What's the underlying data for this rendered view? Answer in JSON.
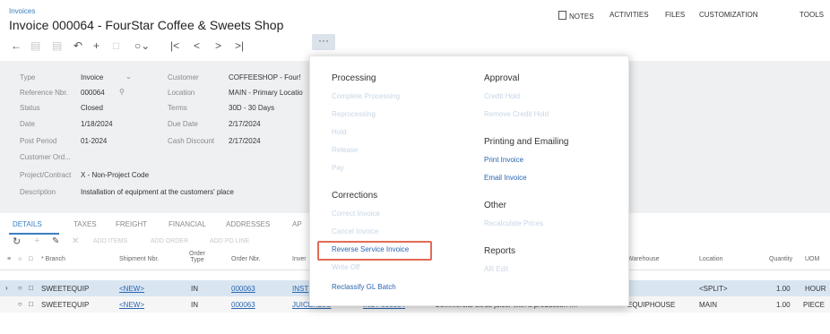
{
  "header": {
    "breadcrumb": "Invoices",
    "title": "Invoice 000064 - FourStar Coffee & Sweets Shop",
    "links": [
      "NOTES",
      "ACTIVITIES",
      "FILES",
      "CUSTOMIZATION",
      "TOOLS"
    ]
  },
  "toolbar": {
    "more": "···"
  },
  "form": {
    "type": {
      "label": "Type",
      "value": "Invoice"
    },
    "reference": {
      "label": "Reference Nbr.",
      "value": "000064"
    },
    "status": {
      "label": "Status",
      "value": "Closed"
    },
    "date": {
      "label": "Date",
      "value": "1/18/2024"
    },
    "post_period": {
      "label": "Post Period",
      "value": "01-2024"
    },
    "customer_ord": {
      "label": "Customer Ord..."
    },
    "project": {
      "label": "Project/Contract",
      "value": "X - Non-Project Code"
    },
    "description": {
      "label": "Description",
      "value": "Installation of equipment at the customers' place"
    },
    "customer": {
      "label": "Customer",
      "value": "COFFEESHOP - Four!"
    },
    "location": {
      "label": "Location",
      "value": "MAIN - Primary Locatio"
    },
    "terms": {
      "label": "Terms",
      "value": "30D - 30 Days"
    },
    "due_date": {
      "label": "Due Date",
      "value": "2/17/2024"
    },
    "cash_discount": {
      "label": "Cash Discount",
      "value": "2/17/2024"
    }
  },
  "tabs": [
    "DETAILS",
    "TAXES",
    "FREIGHT",
    "FINANCIAL",
    "ADDRESSES",
    "AP"
  ],
  "grid_toolbar": [
    "ADD ITEMS",
    "ADD ORDER",
    "ADD PO LINE"
  ],
  "columns": [
    "* Branch",
    "Shipment Nbr.",
    "Order Type",
    "Order Nbr.",
    "Inver",
    "Warehouse",
    "Location",
    "Quantity",
    "UOM"
  ],
  "rows": [
    {
      "branch": "SWEETEQUIP",
      "shipment": "<NEW>",
      "order_type": "IN",
      "order_nbr": "000063",
      "inventory": "INST",
      "description": "",
      "warehouse": "",
      "location": "<SPLIT>",
      "quantity": "1.00",
      "uom": "HOUR"
    },
    {
      "branch": "SWEETEQUIP",
      "shipment": "<NEW>",
      "order_type": "IN",
      "order_nbr": "000063",
      "inventory": "JUICER20C",
      "inventory2": "INST 000004",
      "description": "Commercial citrus juicer with a production r...",
      "warehouse": "EQUIPHOUSE",
      "location": "MAIN",
      "quantity": "1.00",
      "uom": "PIECE"
    }
  ],
  "menu": {
    "processing": {
      "title": "Processing",
      "items": [
        "Complete Processing",
        "Reprocessing",
        "Hold",
        "Release",
        "Pay"
      ]
    },
    "corrections": {
      "title": "Corrections",
      "items": [
        "Correct Invoice",
        "Cancel Invoice",
        "Reverse Service Invoice",
        "Write Off",
        "Reclassify GL Batch"
      ]
    },
    "approval": {
      "title": "Approval",
      "items": [
        "Credit Hold",
        "Remove Credit Hold"
      ]
    },
    "printing": {
      "title": "Printing and Emailing",
      "items": [
        "Print Invoice",
        "Email Invoice"
      ]
    },
    "other": {
      "title": "Other",
      "items": [
        "Recalculate Prices"
      ]
    },
    "reports": {
      "title": "Reports",
      "items": [
        "AR Edit"
      ]
    }
  }
}
